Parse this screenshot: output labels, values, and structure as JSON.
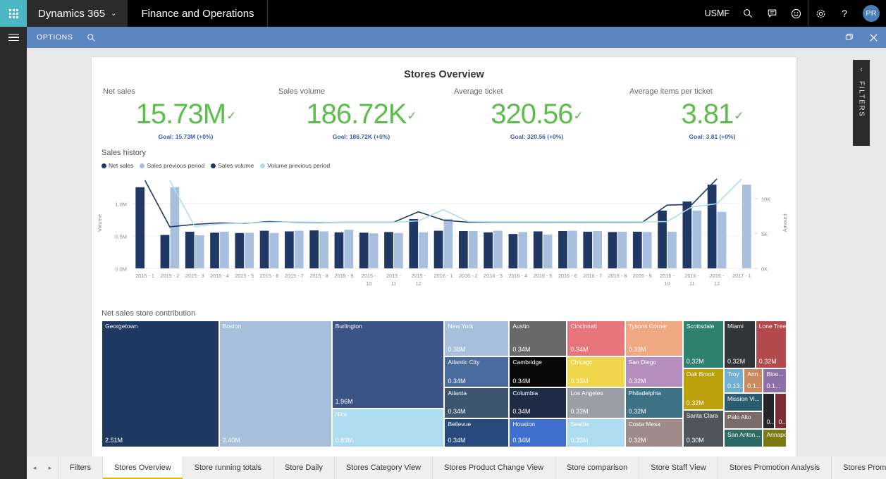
{
  "topnav": {
    "waffle_label": "app-launcher",
    "brand": "Dynamics 365",
    "brand_chevron": "⌄",
    "module": "Finance and Operations",
    "company": "USMF",
    "icons": [
      "search-icon",
      "feedback-icon",
      "smiley-icon",
      "gear-icon",
      "help-icon"
    ],
    "help": "?",
    "avatar_initials": "PR"
  },
  "optionsbar": {
    "menu_label": "OPTIONS",
    "search_icon": "search-icon",
    "restore_icon": "restore-window-icon",
    "close_icon": "close-icon"
  },
  "filters_panel": {
    "label": "FILTERS",
    "collapse_chevron": "‹"
  },
  "report": {
    "title": "Stores Overview",
    "kpis": [
      {
        "label": "Net sales",
        "value": "15.73M",
        "goal": "Goal: 15.73M (+0%)"
      },
      {
        "label": "Sales volume",
        "value": "186.72K",
        "goal": "Goal: 186.72K (+0%)"
      },
      {
        "label": "Average ticket",
        "value": "320.56",
        "goal": "Goal: 320.56 (+0%)"
      },
      {
        "label": "Average items per ticket",
        "value": "3.81",
        "goal": "Goal: 3.81 (+0%)"
      }
    ],
    "sales_history_title": "Sales history",
    "treemap_title": "Net sales store contribution"
  },
  "chart_data": {
    "type": "bar",
    "title": "Sales history",
    "xlabel": "",
    "ylabel": "Volume",
    "y2label": "Amount",
    "ylim": [
      0,
      1400000
    ],
    "yticks": [
      "0.0M",
      "0.5M",
      "1.0M"
    ],
    "ytickvals": [
      0,
      500000,
      1000000
    ],
    "y2lim": [
      0,
      13000
    ],
    "y2ticks": [
      "0K",
      "5K",
      "10K"
    ],
    "y2tickvals": [
      0,
      5000,
      10000
    ],
    "grid": true,
    "legend_position": "top-left",
    "legend": [
      {
        "name": "Net sales",
        "color": "#1F3864"
      },
      {
        "name": "Sales previous period",
        "color": "#A8C0DE"
      },
      {
        "name": "Sales volume",
        "color": "#1F3864"
      },
      {
        "name": "Volume previous period",
        "color": "#AEDCF0"
      }
    ],
    "categories": [
      "2015 - 1",
      "2015 - 2",
      "2015 - 3",
      "2015 - 4",
      "2015 - 5",
      "2015 - 6",
      "2015 - 7",
      "2015 - 8",
      "2015 - 9",
      "2015 - 10",
      "2015 - 11",
      "2015 - 12",
      "2016 - 1",
      "2016 - 2",
      "2016 - 3",
      "2016 - 4",
      "2016 - 5",
      "2016 - 6",
      "2016 - 7",
      "2016 - 8",
      "2016 - 9",
      "2016 - 10",
      "2016 - 11",
      "2016 - 12",
      "2017 - 1"
    ],
    "series": [
      {
        "name": "Net sales",
        "type": "bar",
        "color": "#1F3864",
        "axis": "left",
        "values": [
          1250000,
          515000,
          565000,
          550000,
          545000,
          580000,
          570000,
          585000,
          555000,
          550000,
          560000,
          760000,
          580000,
          575000,
          555000,
          530000,
          570000,
          575000,
          565000,
          560000,
          565000,
          890000,
          1030000,
          1290000,
          0
        ]
      },
      {
        "name": "Sales previous period",
        "type": "bar",
        "color": "#A8C0DE",
        "axis": "left",
        "values": [
          0,
          1250000,
          510000,
          565000,
          548000,
          545000,
          580000,
          570000,
          595000,
          540000,
          545000,
          555000,
          760000,
          575000,
          580000,
          560000,
          520000,
          580000,
          575000,
          565000,
          560000,
          565000,
          890000,
          870000,
          1290000
        ]
      },
      {
        "name": "Sales volume",
        "type": "line",
        "color": "#1F3864",
        "axis": "right",
        "values": [
          12600,
          5950,
          6300,
          6500,
          6450,
          6700,
          6600,
          6550,
          6600,
          6600,
          6600,
          8100,
          6900,
          6600,
          6600,
          6600,
          6600,
          6600,
          6600,
          6600,
          6600,
          9050,
          9150,
          12800,
          null
        ]
      },
      {
        "name": "Volume previous period",
        "type": "line",
        "color": "#AEDCF0",
        "axis": "right",
        "values": [
          null,
          12600,
          6000,
          6350,
          6500,
          6600,
          6650,
          6600,
          6600,
          6600,
          6600,
          6800,
          8400,
          6700,
          6650,
          6650,
          6650,
          6650,
          6650,
          6650,
          6650,
          6700,
          8800,
          9250,
          12800
        ]
      }
    ]
  },
  "treemap_data": {
    "type": "treemap",
    "title": "Net sales store contribution",
    "tiles": [
      {
        "name": "Georgetown",
        "value": "2.51M",
        "color": "#1F3864",
        "x": 0,
        "y": 0,
        "w": 17.15,
        "h": 100
      },
      {
        "name": "Boston",
        "value": "2.40M",
        "color": "#A8C0DE",
        "x": 17.15,
        "y": 0,
        "w": 16.45,
        "h": 100
      },
      {
        "name": "Burlington",
        "value": "1.96M",
        "color": "#3B5488",
        "x": 33.6,
        "y": 0,
        "w": 16.45,
        "h": 69.5
      },
      {
        "name": "Nice",
        "value": "0.89M",
        "color": "#AEDCF0",
        "x": 33.6,
        "y": 69.5,
        "w": 16.45,
        "h": 30.5
      },
      {
        "name": "New York",
        "value": "0.38M",
        "color": "#A8C0DE",
        "x": 50.05,
        "y": 0,
        "w": 9.45,
        "h": 28.5
      },
      {
        "name": "Atlantic City",
        "value": "0.34M",
        "color": "#4A6B9E",
        "x": 50.05,
        "y": 28.5,
        "w": 9.45,
        "h": 24.5
      },
      {
        "name": "Atlanta",
        "value": "0.34M",
        "color": "#3D556F",
        "x": 50.05,
        "y": 53.0,
        "w": 9.45,
        "h": 24.0
      },
      {
        "name": "Bellevue",
        "value": "0.34M",
        "color": "#27497E",
        "x": 50.05,
        "y": 77.0,
        "w": 9.45,
        "h": 23.0
      },
      {
        "name": "Austin",
        "value": "0.34M",
        "color": "#696969",
        "x": 59.5,
        "y": 0,
        "w": 8.45,
        "h": 28.5
      },
      {
        "name": "Cambridge",
        "value": "0.34M",
        "color": "#0A0A0A",
        "x": 59.5,
        "y": 28.5,
        "w": 8.45,
        "h": 24.5
      },
      {
        "name": "Columbia",
        "value": "0.34M",
        "color": "#1D2B45",
        "x": 59.5,
        "y": 53.0,
        "w": 8.45,
        "h": 24.0
      },
      {
        "name": "Houston",
        "value": "0.34M",
        "color": "#3F6FCF",
        "x": 59.5,
        "y": 77.0,
        "w": 8.45,
        "h": 23.0
      },
      {
        "name": "Cincinnati",
        "value": "0.34M",
        "color": "#E8747C",
        "x": 67.95,
        "y": 0,
        "w": 8.45,
        "h": 28.5
      },
      {
        "name": "Chicago",
        "value": "0.33M",
        "color": "#EFD košt",
        "x": 67.95,
        "y": 28.5,
        "w": 8.45,
        "h": 24.5
      },
      {
        "name": "Los Angeles",
        "value": "0.33M",
        "color": "#9A9FA6",
        "x": 67.95,
        "y": 53.0,
        "w": 8.45,
        "h": 24.0
      },
      {
        "name": "Seattle",
        "value": "0.33M",
        "color": "#AEDCF0",
        "x": 67.95,
        "y": 77.0,
        "w": 8.45,
        "h": 23.0
      },
      {
        "name": "Tysons Corner",
        "value": "0.33M",
        "color": "#F0A882",
        "x": 76.4,
        "y": 0,
        "w": 8.45,
        "h": 28.5
      },
      {
        "name": "San Diego",
        "value": "0.32M",
        "color": "#B48FBE",
        "x": 76.4,
        "y": 28.5,
        "w": 8.45,
        "h": 24.5
      },
      {
        "name": "Philadelphia",
        "value": "0.32M",
        "color": "#3C7186",
        "x": 76.4,
        "y": 53.0,
        "w": 8.45,
        "h": 24.0
      },
      {
        "name": "Costa Mesa",
        "value": "0.32M",
        "color": "#A08B8B",
        "x": 76.4,
        "y": 77.0,
        "w": 8.45,
        "h": 23.0
      },
      {
        "name": "Scottsdale",
        "value": "0.32M",
        "color": "#2E8070",
        "x": 84.85,
        "y": 0,
        "w": 6.0,
        "h": 37.5
      },
      {
        "name": "Oak Brook",
        "value": "0.32M",
        "color": "#BCA00C",
        "x": 84.85,
        "y": 37.5,
        "w": 6.0,
        "h": 33.0
      },
      {
        "name": "Santa Clara",
        "value": "0.30M",
        "color": "#4F5558",
        "x": 84.85,
        "y": 70.5,
        "w": 6.0,
        "h": 29.5
      },
      {
        "name": "Miami",
        "value": "0.32M",
        "color": "#333638",
        "x": 90.85,
        "y": 0,
        "w": 4.6,
        "h": 37.5
      },
      {
        "name": "Lone Tree",
        "value": "0.32M",
        "color": "#B34A4E",
        "x": 95.45,
        "y": 0,
        "w": 4.55,
        "h": 37.5
      },
      {
        "name": "Troy",
        "value": "0.13...",
        "color": "#6FAFD2",
        "x": 90.85,
        "y": 37.5,
        "w": 2.9,
        "h": 19.5
      },
      {
        "name": "Ann ...",
        "value": "0.1...",
        "color": "#C88A5E",
        "x": 93.75,
        "y": 37.5,
        "w": 2.8,
        "h": 19.5
      },
      {
        "name": "Bloo...",
        "value": "0.1...",
        "color": "#8F6FA8",
        "x": 96.55,
        "y": 37.5,
        "w": 3.45,
        "h": 19.5
      },
      {
        "name": "Mission Vi...",
        "value": "",
        "color": "#2C5C70",
        "x": 90.85,
        "y": 57.0,
        "w": 5.7,
        "h": 14.5
      },
      {
        "name": "Palo Alto",
        "value": "",
        "color": "#7A6A6A",
        "x": 90.85,
        "y": 71.5,
        "w": 5.7,
        "h": 14.0
      },
      {
        "name": "San Anton...",
        "value": "",
        "color": "#2D6A63",
        "x": 90.85,
        "y": 85.5,
        "w": 5.7,
        "h": 14.5
      },
      {
        "name": "",
        "value": "0....",
        "color": "#232528",
        "x": 96.55,
        "y": 57.0,
        "w": 1.75,
        "h": 28.5
      },
      {
        "name": "",
        "value": "0...",
        "color": "#7A2E32",
        "x": 98.3,
        "y": 57.0,
        "w": 1.7,
        "h": 28.5
      },
      {
        "name": "Annapolis",
        "value": "",
        "color": "#7A7A10",
        "x": 96.55,
        "y": 85.5,
        "w": 3.45,
        "h": 14.5
      }
    ]
  },
  "tabs": {
    "prev_arrow": "◂",
    "next_arrow": "▸",
    "items": [
      {
        "label": "Filters",
        "active": false
      },
      {
        "label": "Stores Overview",
        "active": true
      },
      {
        "label": "Store running totals",
        "active": false
      },
      {
        "label": "Store Daily",
        "active": false
      },
      {
        "label": "Stores Category View",
        "active": false
      },
      {
        "label": "Stores Product Change View",
        "active": false
      },
      {
        "label": "Store comparison",
        "active": false
      },
      {
        "label": "Store Staff View",
        "active": false
      },
      {
        "label": "Stores Promotion Analysis",
        "active": false
      },
      {
        "label": "Stores Promotion Impact Analysis",
        "active": false
      }
    ]
  },
  "colors": {
    "brand_bar": "#000000",
    "waffle": "#4BB8C4",
    "options_bar": "#5B86BF",
    "kpi_green": "#5BBE4B",
    "goal_blue": "#3B5EA8",
    "active_tab_underline": "#E8B900",
    "dark_navy": "#1F3864",
    "light_blue": "#A8C0DE"
  }
}
